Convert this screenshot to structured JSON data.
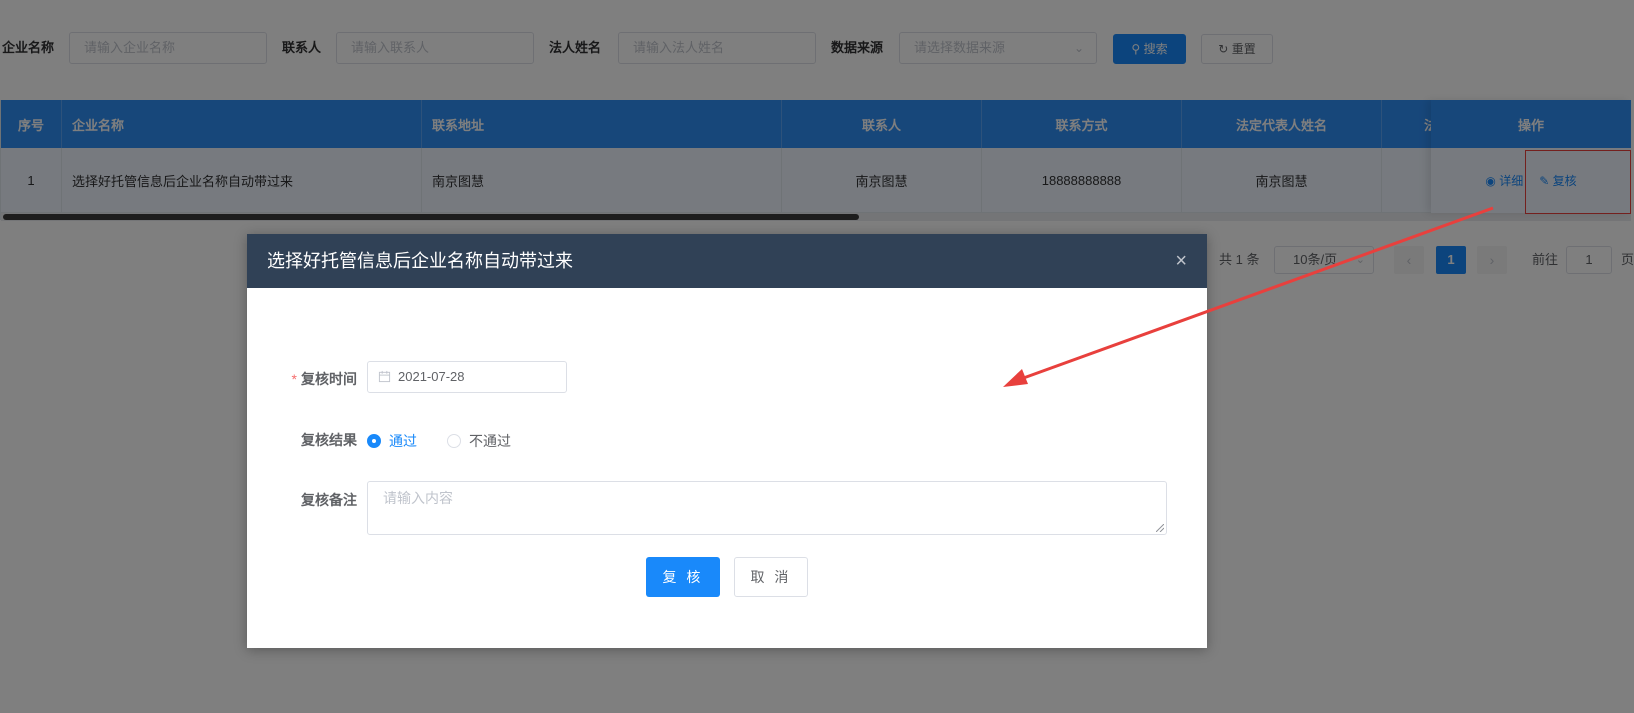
{
  "filters": {
    "company_label": "企业名称",
    "company_placeholder": "请输入企业名称",
    "contact_label": "联系人",
    "contact_placeholder": "请输入联系人",
    "legal_label": "法人姓名",
    "legal_placeholder": "请输入法人姓名",
    "source_label": "数据来源",
    "source_placeholder": "请选择数据来源",
    "search_button": "搜索",
    "reset_button": "重置"
  },
  "table": {
    "columns": [
      "序号",
      "企业名称",
      "联系地址",
      "联系人",
      "联系方式",
      "法定代表人姓名",
      "法",
      "操作"
    ],
    "rows": [
      {
        "index": "1",
        "company": "选择好托管信息后企业名称自动带过来",
        "address": "南京图慧",
        "contact": "南京图慧",
        "phone": "18888888888",
        "legal": "南京图慧"
      }
    ],
    "actions": {
      "detail": "详细",
      "review": "复核"
    }
  },
  "pagination": {
    "total": "共 1 条",
    "page_size": "10条/页",
    "current_page": "1",
    "goto_label": "前往",
    "goto_value": "1",
    "page_suffix": "页"
  },
  "dialog": {
    "title": "选择好托管信息后企业名称自动带过来",
    "review_time_label": "复核时间",
    "review_time_value": "2021-07-28",
    "result_label": "复核结果",
    "result_options": [
      "通过",
      "不通过"
    ],
    "selected_result": "通过",
    "remark_label": "复核备注",
    "remark_placeholder": "请输入内容",
    "confirm_button": "复 核",
    "cancel_button": "取 消"
  },
  "colors": {
    "primary": "#1989fa",
    "header_bg": "#2f8ef5",
    "dialog_header": "#304156",
    "annotation": "#e8403d"
  }
}
